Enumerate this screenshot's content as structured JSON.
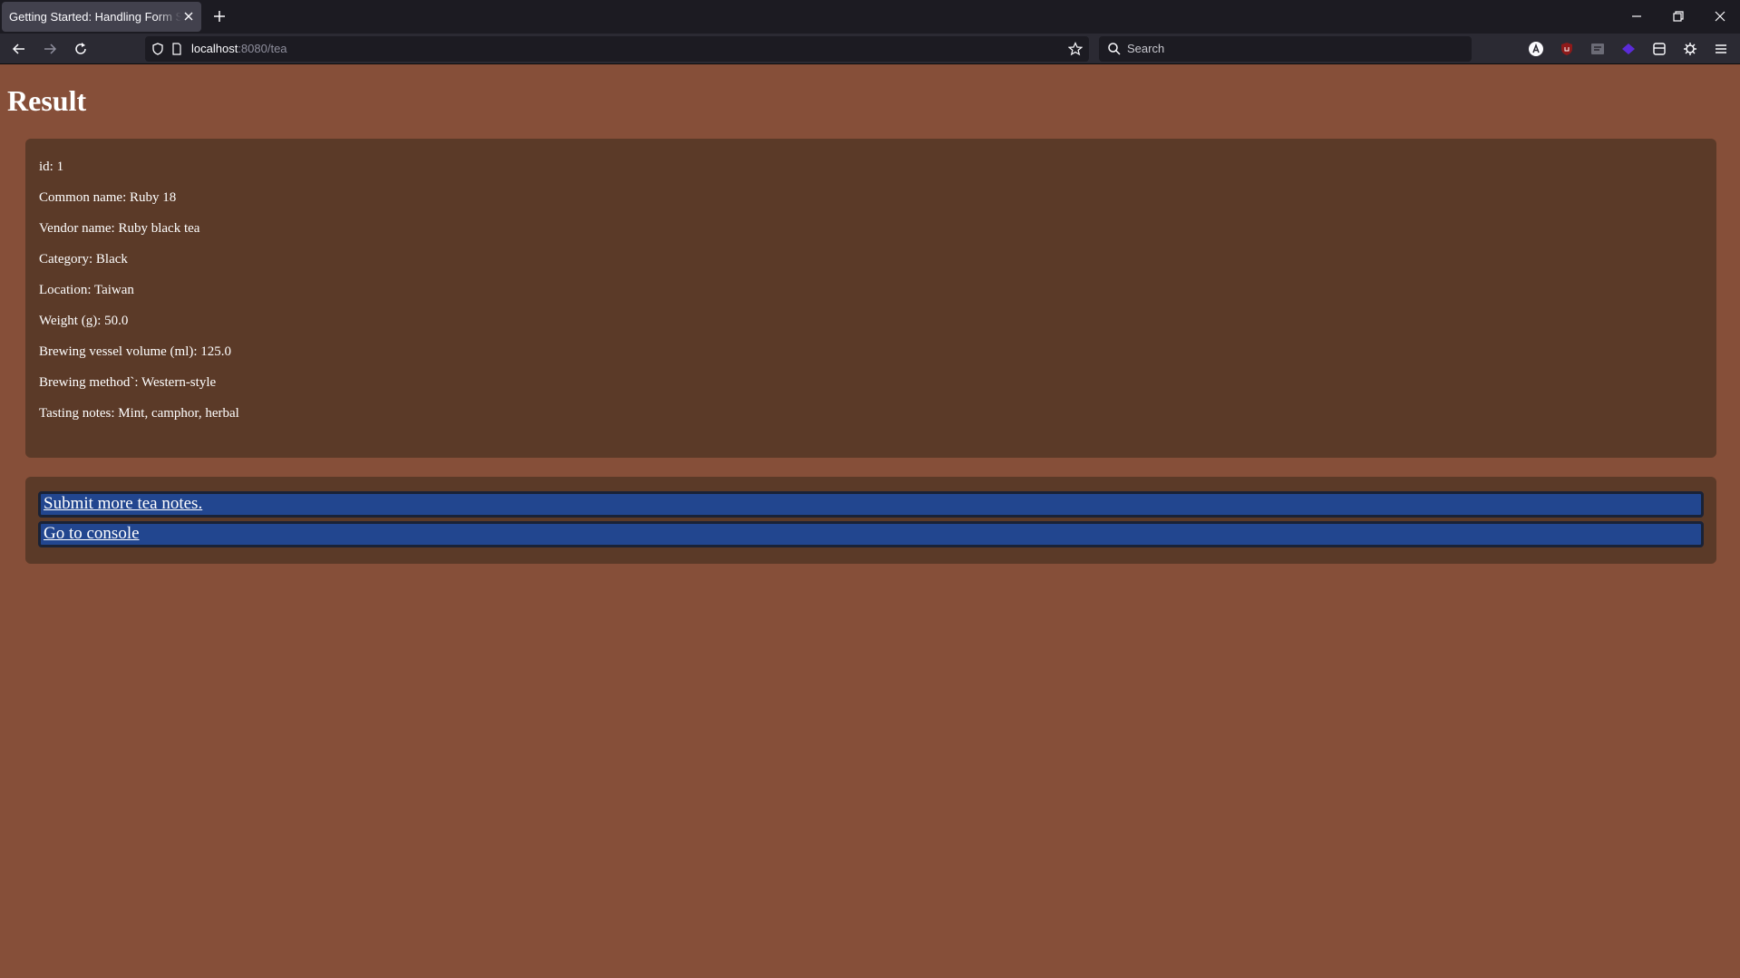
{
  "browser": {
    "tab_title": "Getting Started: Handling Form Submission",
    "url_host": "localhost",
    "url_path": ":8080/tea",
    "search_placeholder": "Search"
  },
  "page": {
    "title": "Result"
  },
  "result": {
    "fields": [
      "id: 1",
      "Common name: Ruby 18",
      "Vendor name: Ruby black tea",
      "Category: Black",
      "Location: Taiwan",
      "Weight (g): 50.0",
      "Brewing vessel volume (ml): 125.0",
      "Brewing method`: Western-style",
      "Tasting notes: Mint, camphor, herbal"
    ]
  },
  "links": {
    "submit_more": "Submit more tea notes.",
    "console": "Go to console"
  },
  "colors": {
    "page_background": "#864f39",
    "card_background": "#5b3a28",
    "link_background": "#22468f"
  }
}
